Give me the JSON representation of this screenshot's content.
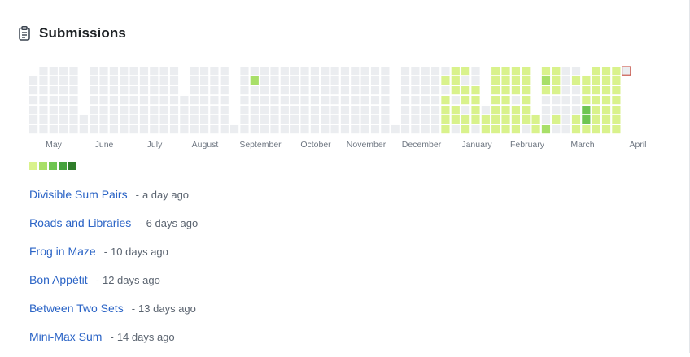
{
  "header": {
    "title": "Submissions",
    "icon": "clipboard-icon"
  },
  "colors": {
    "empty": "#ebedf0",
    "levels": [
      "#d9f28c",
      "#a8df68",
      "#6fc551",
      "#45a23c",
      "#2f7d2a"
    ],
    "today_outline": "#c0392b",
    "link": "#2b64c6"
  },
  "heatmap": {
    "months": [
      "May",
      "June",
      "July",
      "August",
      "September",
      "October",
      "November",
      "December",
      "January",
      "February",
      "March",
      "April"
    ],
    "rows": 7,
    "columns": [
      [
        null,
        0,
        0,
        0,
        0,
        0,
        0
      ],
      [
        0,
        0,
        0,
        0,
        0,
        0,
        0
      ],
      [
        0,
        0,
        0,
        0,
        0,
        0,
        0
      ],
      [
        0,
        0,
        0,
        0,
        0,
        0,
        0
      ],
      [
        0,
        0,
        0,
        0,
        0,
        0,
        0
      ],
      [
        null,
        null,
        null,
        null,
        null,
        0,
        0
      ],
      [
        0,
        0,
        0,
        0,
        0,
        0,
        0
      ],
      [
        0,
        0,
        0,
        0,
        0,
        0,
        0
      ],
      [
        0,
        0,
        0,
        0,
        0,
        0,
        0
      ],
      [
        0,
        0,
        0,
        0,
        0,
        0,
        0
      ],
      [
        0,
        0,
        0,
        0,
        0,
        0,
        0
      ],
      [
        0,
        0,
        0,
        0,
        0,
        0,
        0
      ],
      [
        0,
        0,
        0,
        0,
        0,
        0,
        0
      ],
      [
        0,
        0,
        0,
        0,
        0,
        0,
        0
      ],
      [
        0,
        0,
        0,
        0,
        0,
        0,
        0
      ],
      [
        null,
        null,
        null,
        0,
        0,
        0,
        0
      ],
      [
        0,
        0,
        0,
        0,
        0,
        0,
        0
      ],
      [
        0,
        0,
        0,
        0,
        0,
        0,
        0
      ],
      [
        0,
        0,
        0,
        0,
        0,
        0,
        0
      ],
      [
        0,
        0,
        0,
        0,
        0,
        0,
        0
      ],
      [
        null,
        null,
        null,
        null,
        null,
        null,
        0
      ],
      [
        0,
        0,
        0,
        0,
        0,
        0,
        0
      ],
      [
        0,
        2,
        0,
        0,
        0,
        0,
        0
      ],
      [
        0,
        0,
        0,
        0,
        0,
        0,
        0
      ],
      [
        0,
        0,
        0,
        0,
        0,
        0,
        0
      ],
      [
        0,
        0,
        0,
        0,
        0,
        0,
        0
      ],
      [
        0,
        0,
        0,
        0,
        0,
        0,
        0
      ],
      [
        0,
        0,
        0,
        0,
        0,
        0,
        0
      ],
      [
        0,
        0,
        0,
        0,
        0,
        0,
        0
      ],
      [
        0,
        0,
        0,
        0,
        0,
        0,
        0
      ],
      [
        0,
        0,
        0,
        0,
        0,
        0,
        0
      ],
      [
        0,
        0,
        0,
        0,
        0,
        0,
        0
      ],
      [
        0,
        0,
        0,
        0,
        0,
        0,
        0
      ],
      [
        0,
        0,
        0,
        0,
        0,
        0,
        0
      ],
      [
        0,
        0,
        0,
        0,
        0,
        0,
        0
      ],
      [
        0,
        0,
        0,
        0,
        0,
        0,
        0
      ],
      [
        null,
        null,
        null,
        null,
        null,
        null,
        0
      ],
      [
        0,
        0,
        0,
        0,
        0,
        0,
        0
      ],
      [
        0,
        0,
        0,
        0,
        0,
        0,
        0
      ],
      [
        0,
        0,
        0,
        0,
        0,
        0,
        0
      ],
      [
        0,
        0,
        0,
        0,
        0,
        0,
        0
      ],
      [
        0,
        1,
        0,
        1,
        1,
        1,
        1
      ],
      [
        1,
        1,
        1,
        0,
        1,
        1,
        0
      ],
      [
        1,
        0,
        1,
        1,
        0,
        1,
        1
      ],
      [
        0,
        0,
        1,
        1,
        1,
        1,
        0
      ],
      [
        null,
        null,
        null,
        null,
        0,
        1,
        1
      ],
      [
        1,
        1,
        1,
        1,
        1,
        1,
        1
      ],
      [
        1,
        1,
        1,
        1,
        1,
        1,
        1
      ],
      [
        1,
        1,
        1,
        0,
        1,
        1,
        1
      ],
      [
        1,
        1,
        1,
        1,
        1,
        1,
        0
      ],
      [
        null,
        null,
        null,
        null,
        null,
        1,
        1
      ],
      [
        1,
        2,
        1,
        0,
        0,
        0,
        2
      ],
      [
        1,
        1,
        1,
        0,
        0,
        1,
        0
      ],
      [
        0,
        0,
        0,
        0,
        0,
        0,
        0
      ],
      [
        0,
        1,
        0,
        0,
        0,
        1,
        1
      ],
      [
        null,
        1,
        1,
        1,
        3,
        3,
        1
      ],
      [
        1,
        1,
        1,
        1,
        1,
        1,
        1
      ],
      [
        1,
        1,
        1,
        1,
        1,
        1,
        1
      ],
      [
        1,
        1,
        1,
        1,
        1,
        1,
        1
      ],
      [
        0,
        null,
        null,
        null,
        null,
        null,
        null
      ]
    ],
    "today": {
      "column": 59,
      "row": 0
    }
  },
  "legend": {
    "levels": [
      1,
      2,
      3,
      4,
      5
    ]
  },
  "submissions": [
    {
      "name": "Divisible Sum Pairs",
      "separator": "-",
      "time": "a day ago"
    },
    {
      "name": "Roads and Libraries",
      "separator": "-",
      "time": "6 days ago"
    },
    {
      "name": "Frog in Maze",
      "separator": "-",
      "time": "10 days ago"
    },
    {
      "name": "Bon Appétit",
      "separator": "-",
      "time": "12 days ago"
    },
    {
      "name": "Between Two Sets",
      "separator": "-",
      "time": "13 days ago"
    },
    {
      "name": "Mini-Max Sum",
      "separator": "-",
      "time": "14 days ago"
    }
  ]
}
